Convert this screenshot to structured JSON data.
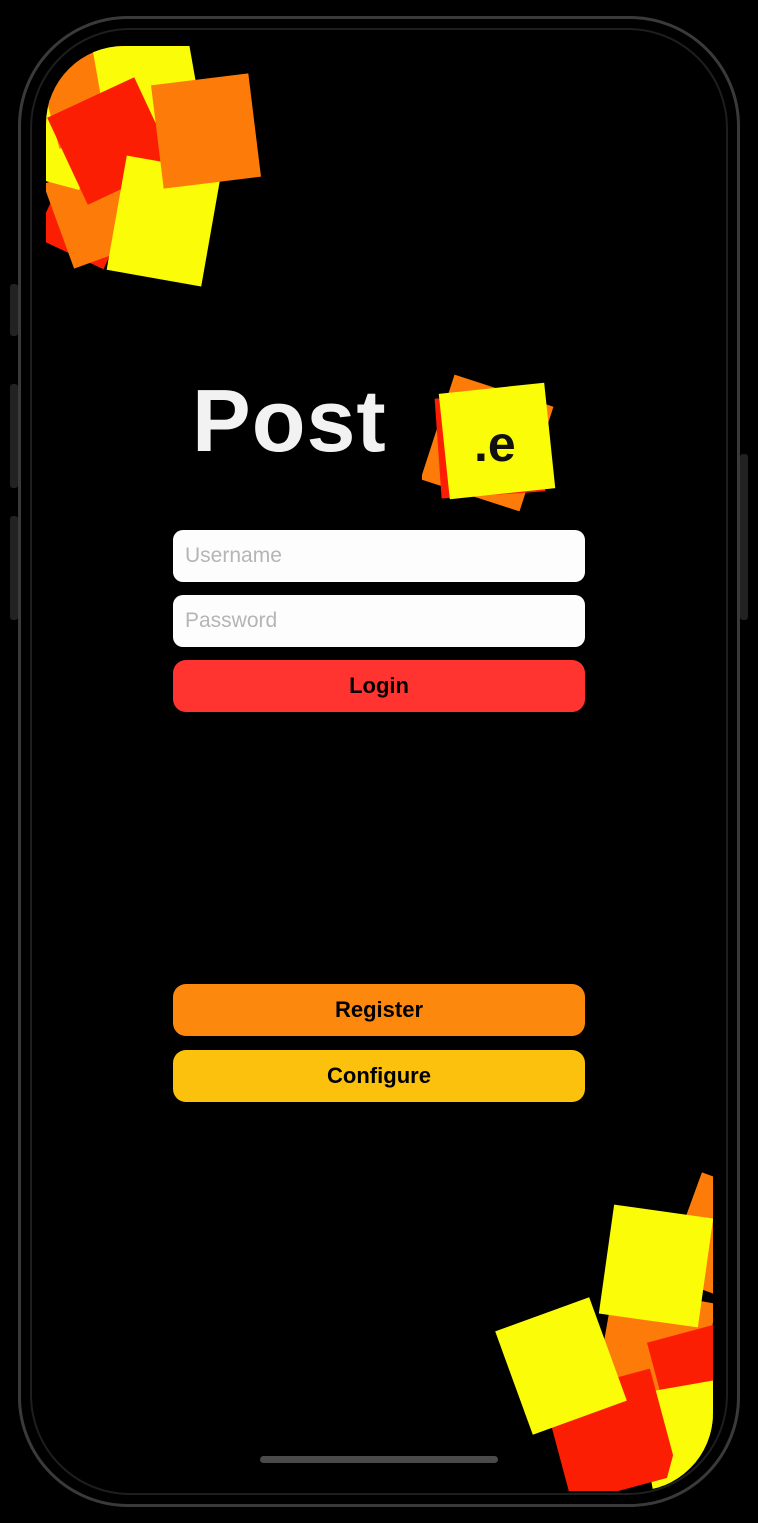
{
  "logo": {
    "brand_text": "Post",
    "mark_text": ".e"
  },
  "form": {
    "username": {
      "placeholder": "Username",
      "value": ""
    },
    "password": {
      "placeholder": "Password",
      "value": ""
    },
    "login_label": "Login"
  },
  "actions": {
    "register_label": "Register",
    "configure_label": "Configure"
  },
  "colors": {
    "background": "#000000",
    "login": "#ff3430",
    "register": "#fc880d",
    "configure": "#fbc10d",
    "deco_yellow": "#fbfc07",
    "deco_orange": "#fc7b09",
    "deco_red": "#fc1e03"
  }
}
